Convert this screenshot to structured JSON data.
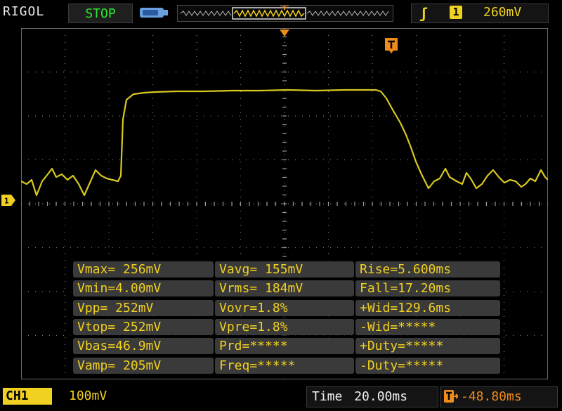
{
  "header": {
    "brand": "RIGOL",
    "run_status": "STOP",
    "trigger_level": "260mV",
    "trigger_source": "1",
    "trigger_marker_label": "T"
  },
  "channel": {
    "badge": "CH1",
    "marker": "1",
    "scale": "100mV"
  },
  "footer": {
    "time_label": "Time",
    "time_value": "20.00ms",
    "trigger_offset": "-48.80ms"
  },
  "measurements": {
    "col1": [
      "Vmax= 256mV",
      "Vmin=4.00mV",
      "Vpp= 252mV",
      "Vtop= 252mV",
      "Vbas=46.9mV",
      "Vamp= 205mV"
    ],
    "col2": [
      "Vavg= 155mV",
      "Vrms= 184mV",
      "Vovr=1.8%",
      "Vpre=1.8%",
      "Prd=*****",
      "Freq=*****"
    ],
    "col3": [
      "Rise=5.600ms",
      "Fall=17.20ms",
      "+Wid=129.6ms",
      "-Wid=*****",
      "+Duty=*****",
      "-Duty=*****"
    ]
  },
  "colors": {
    "trace": "#d8c820",
    "accent": "#f0d020",
    "orange": "#f08a1a",
    "status_green": "#2ee82e"
  }
}
